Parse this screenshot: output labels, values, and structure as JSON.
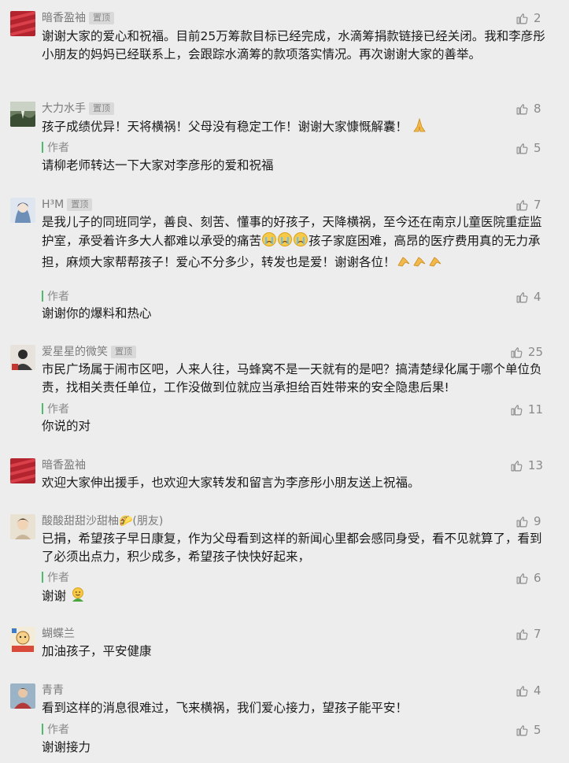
{
  "pin_label": "置顶",
  "author_label": "作者",
  "comments": [
    {
      "name": "暗香盈袖",
      "avatar": "red-stripes-avatar",
      "pinned": true,
      "likes": "2",
      "text": "谢谢大家的爱心和祝福。目前25万筹款目标已经完成，水滴筹捐款链接已经关闭。我和李彦彤小朋友的妈妈已经联系上，会跟踪水滴筹的款项落实情况。再次谢谢大家的善举。"
    },
    {
      "name": "大力水手",
      "avatar": "landscape-avatar",
      "pinned": true,
      "likes": "8",
      "text": "孩子成绩优异！天将横祸！父母没有稳定工作！谢谢大家慷慨解囊！",
      "text_emoji": "pray-emoji",
      "reply": {
        "likes": "5",
        "text": "请柳老师转达一下大家对李彦彤的爱和祝福"
      }
    },
    {
      "name": "H³M",
      "avatar": "anime-avatar",
      "pinned": true,
      "likes": "7",
      "text_parts": [
        "是我儿子的同班同学，善良、刻苦、懂事的好孩子，天降横祸，至今还在南京儿童医院重症监护室，承受着许多大人都难以承受的痛苦",
        "孩子家庭困难，高昂的医疗费用真的无力承担，麻烦大家帮帮孩子！爱心不分多少，转发也是爱！谢谢各位！"
      ],
      "reply": {
        "likes": "4",
        "text": "谢谢你的爆料和热心"
      }
    },
    {
      "name": "爱星星的微笑",
      "avatar": "portrait-avatar",
      "pinned": true,
      "likes": "25",
      "text": "市民广场属于闹市区吧，人来人往，马蜂窝不是一天就有的是吧？搞清楚绿化属于哪个单位负责，找相关责任单位，工作没做到位就应当承担给百姓带来的安全隐患后果!",
      "reply": {
        "likes": "11",
        "text": "你说的对"
      }
    },
    {
      "name": "暗香盈袖",
      "avatar": "red-stripes-avatar",
      "pinned": false,
      "likes": "13",
      "text": "欢迎大家伸出援手，也欢迎大家转发和留言为李彦彤小朋友送上祝福。"
    },
    {
      "name": "酸酸甜甜沙甜柚🌮(朋友)",
      "avatar": "child-avatar",
      "pinned": false,
      "likes": "9",
      "text": "已捐，希望孩子早日康复，作为父母看到这样的新闻心里都会感同身受，看不见就算了，看到了必须出点力，积少成多，希望孩子快快好起来，",
      "reply": {
        "likes": "6",
        "text": "谢谢",
        "text_emoji": "hug-emoji"
      }
    },
    {
      "name": "蝴蝶兰",
      "avatar": "cartoon-avatar",
      "pinned": false,
      "likes": "7",
      "text": "加油孩子，平安健康"
    },
    {
      "name": "青青",
      "avatar": "person-avatar",
      "pinned": false,
      "likes": "4",
      "text": "看到这样的消息很难过，飞来横祸，我们爱心接力，望孩子能平安！",
      "reply": {
        "likes": "5",
        "text": "谢谢接力"
      }
    }
  ],
  "colors": {
    "background": "#ededed",
    "author_bar": "#4fba6f",
    "muted_text": "#8a8a8a",
    "badge_bg": "#d9d9d9"
  }
}
